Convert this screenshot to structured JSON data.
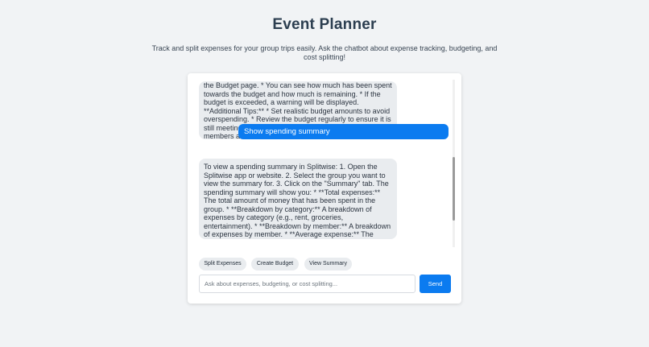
{
  "header": {
    "title": "Event Planner",
    "subtitle": "Track and split expenses for your group trips easily. Ask the chatbot about expense tracking, budgeting, and cost splitting!"
  },
  "chat": {
    "messages": [
      {
        "role": "bot",
        "text": "the Budget page. * You can see how much has been spent towards the budget and how much is remaining. * If the budget is exceeded, a warning will be displayed. **Additional Tips:** * Set realistic budget amounts to avoid overspending. * Review the budget regularly to ensure it is still meeting your needs. * Communicate with group members about the budget and make adjustments as necessary. * Use Splitwise's reporting feature to track budget history and identify areas for improvement."
      },
      {
        "role": "user",
        "text": "Show spending summary"
      },
      {
        "role": "bot",
        "text": "To view a spending summary in Splitwise: 1. Open the Splitwise app or website. 2. Select the group you want to view the summary for. 3. Click on the \"Summary\" tab. The spending summary will show you: * **Total expenses:** The total amount of money that has been spent in the group. * **Breakdown by category:** A breakdown of expenses by category (e.g., rent, groceries, entertainment). * **Breakdown by member:** A breakdown of expenses by member. * **Average expense:** The average amount of money that each member has spent in the"
      }
    ]
  },
  "quick_actions": [
    {
      "label": "Split Expenses"
    },
    {
      "label": "Create Budget"
    },
    {
      "label": "View Summary"
    }
  ],
  "composer": {
    "placeholder": "Ask about expenses, budgeting, or cost splitting...",
    "value": "",
    "send_label": "Send"
  },
  "colors": {
    "accent": "#0b7bf0",
    "bot_bubble": "#e9ecef",
    "page_bg": "#f1f3f5"
  }
}
